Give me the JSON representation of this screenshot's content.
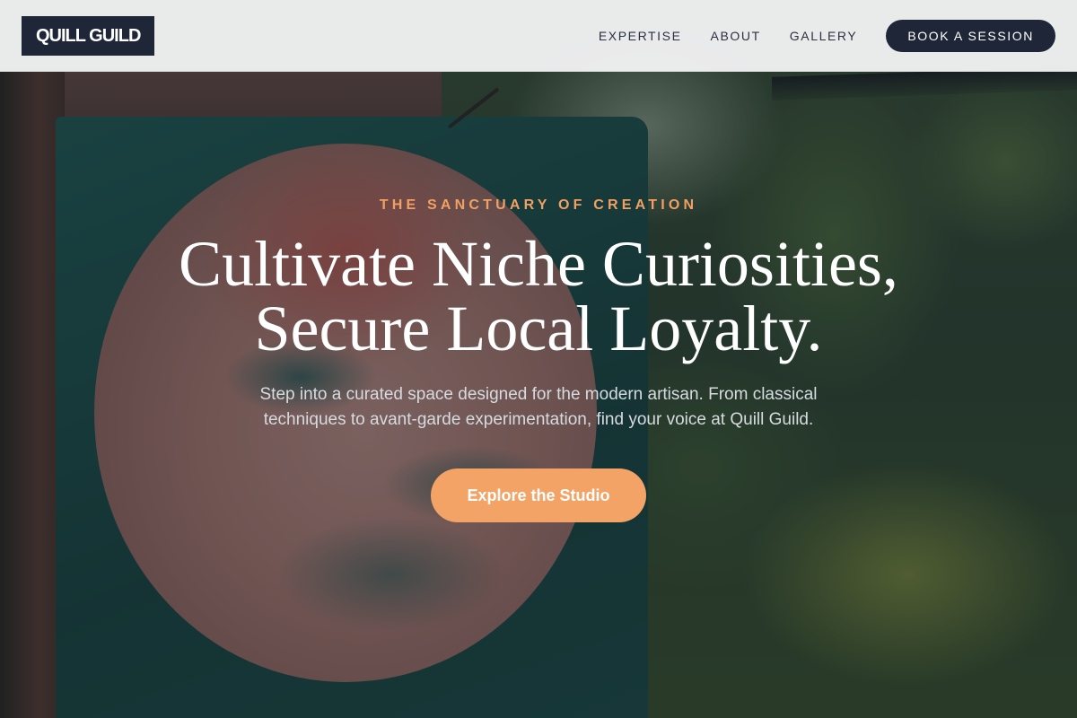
{
  "header": {
    "logo_text": "QUILL GUILD",
    "nav": [
      {
        "label": "EXPERTISE"
      },
      {
        "label": "ABOUT"
      },
      {
        "label": "GALLERY"
      }
    ],
    "cta_label": "BOOK A SESSION"
  },
  "hero": {
    "eyebrow": "THE SANCTUARY OF CREATION",
    "headline_line1": "Cultivate Niche Curiosities,",
    "headline_line2": "Secure Local Loyalty.",
    "subcopy": "Step into a curated space designed for the modern artisan. From classical techniques to avant-garde experimentation, find your voice at Quill Guild.",
    "cta_label": "Explore the Studio"
  },
  "colors": {
    "brand_navy": "#1e2638",
    "accent_orange": "#f4a366",
    "eyebrow_orange": "#f0a063",
    "header_bg": "#f1f1f2"
  }
}
